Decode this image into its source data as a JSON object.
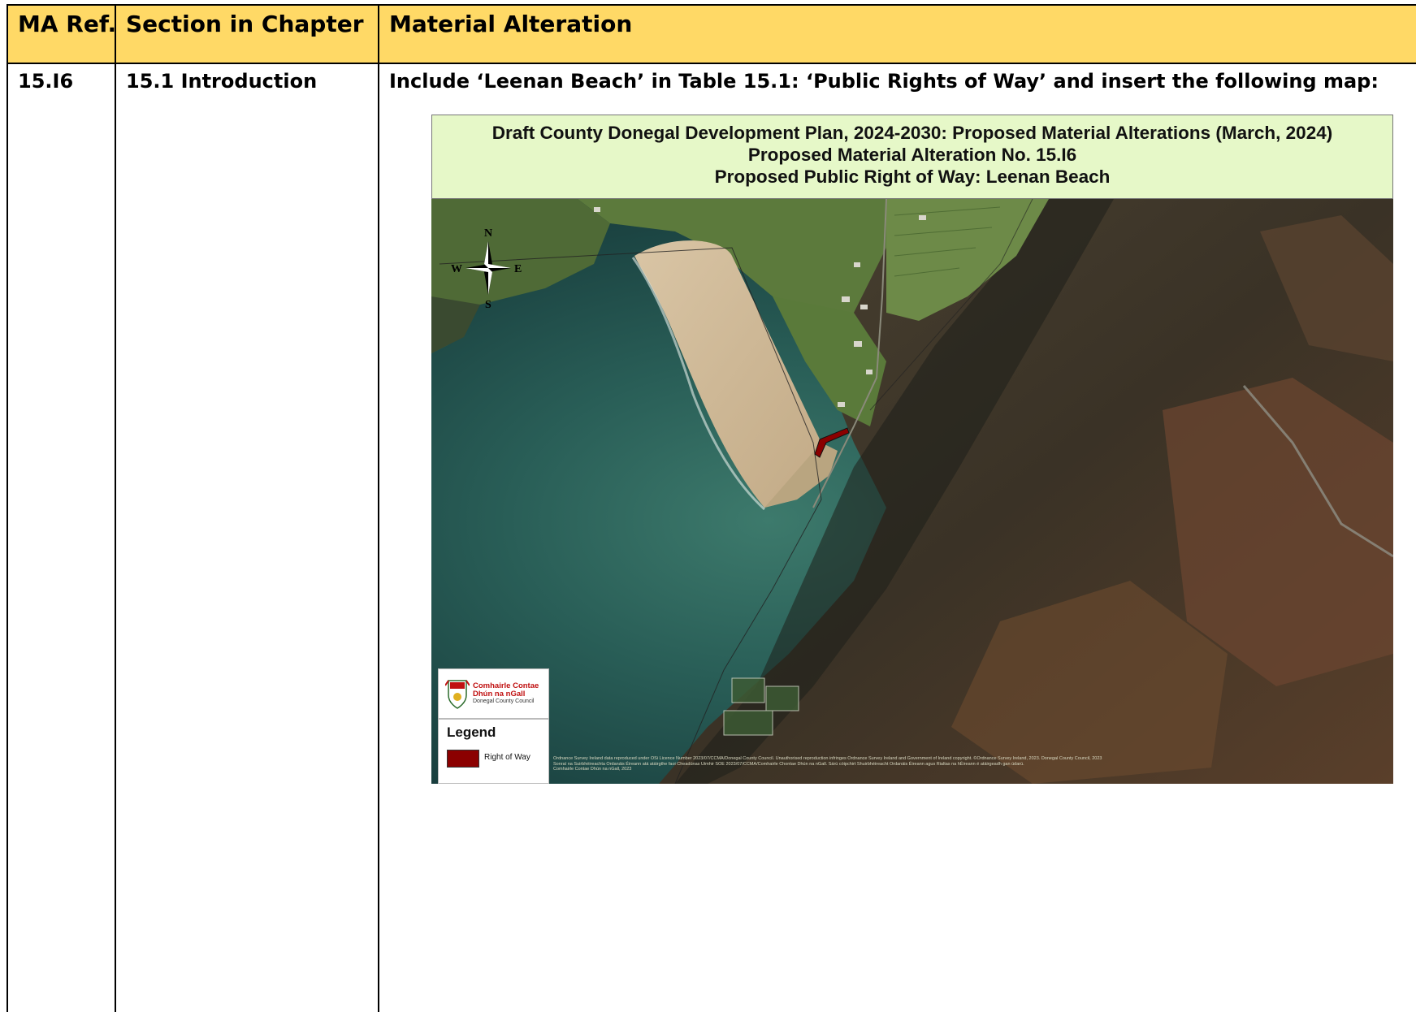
{
  "table": {
    "headers": [
      "MA Ref.",
      "Section in Chapter",
      "Material Alteration"
    ],
    "row": {
      "ref": "15.I6",
      "section": "15.1 Introduction",
      "alteration": "Include ‘Leenan Beach’ in Table 15.1: ‘Public Rights of Way’ and insert the following map:"
    },
    "header_color": "#FFD966"
  },
  "map": {
    "title_lines": [
      "Draft County Donegal Development Plan, 2024-2030: Proposed Material Alterations (March, 2024)",
      "Proposed Material Alteration No. 15.I6",
      "Proposed Public Right of Way: Leenan Beach"
    ],
    "title_bg_color": "#E6F8C8",
    "compass": {
      "n": "N",
      "s": "S",
      "e": "E",
      "w": "W"
    },
    "logo": {
      "line1": "Comhairle Contae",
      "line2": "Dhún na nGall",
      "line3": "Donegal County Council"
    },
    "legend": {
      "title": "Legend",
      "items": [
        {
          "label": "Right of Way",
          "color": "#8B0000"
        }
      ]
    },
    "copyright_lines": [
      "Ordnance Survey Ireland data reproduced under OSi Licence Number 2023/07/CCMA/Donegal County Council. Unauthorised reproduction infringes Ordnance Survey Ireland and Government of Ireland copyright. ©Ordnance Survey Ireland, 2023. Donegal County Council, 2023",
      "Sonraí na Suirbhéireachta Ordanáis Éireann atá atáirgthe faoi Cheadúnas Uimhir SOE 2023/07/CCMA/Comhairle Chontae Dhún na nGall. Sárú cóipchirt Shuirbhéireacht Ordanáis Éireann agus Rialtas na hÉireann é atáirgeadh gan údarú.",
      "Comhairle Contae Dhún na nGall, 2023"
    ]
  }
}
